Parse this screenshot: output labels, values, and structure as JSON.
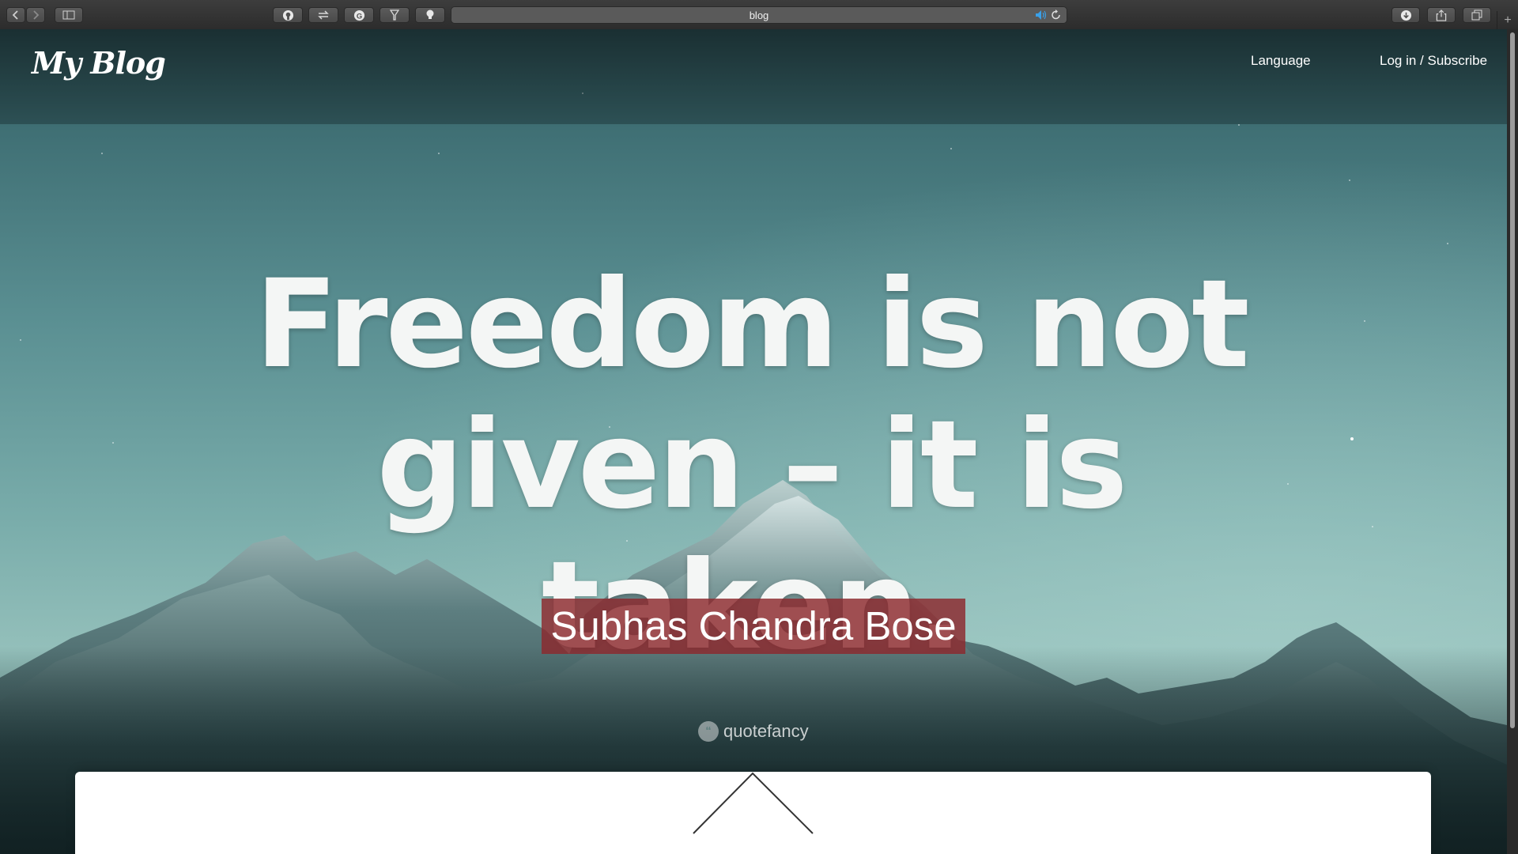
{
  "browser": {
    "address": "blog",
    "new_tab": "+"
  },
  "site": {
    "logo": "My Blog",
    "nav": {
      "language": "Language",
      "login": "Log in / Subscribe"
    }
  },
  "hero": {
    "quote_line1": "Freedom is not",
    "quote_line2": "given – it is taken.",
    "author": "Subhas Chandra Bose",
    "brand": "quotefancy",
    "brand_icon_glyph": "“"
  },
  "colors": {
    "author_bg": "#8c282d",
    "sky_top": "#213a3d",
    "sky_mid": "#7aadab",
    "speaker_accent": "#3aa0e8"
  },
  "icons": {
    "back": "chevron-left-icon",
    "forward": "chevron-right-icon",
    "sidebar": "sidebar-icon",
    "github": "github-icon",
    "swap": "swap-icon",
    "grammarly": "grammarly-icon",
    "filter": "filter-icon",
    "bulb": "lightbulb-icon",
    "speaker": "speaker-icon",
    "reload": "reload-icon",
    "download": "download-icon",
    "share": "share-icon",
    "tabs": "tabs-icon"
  }
}
